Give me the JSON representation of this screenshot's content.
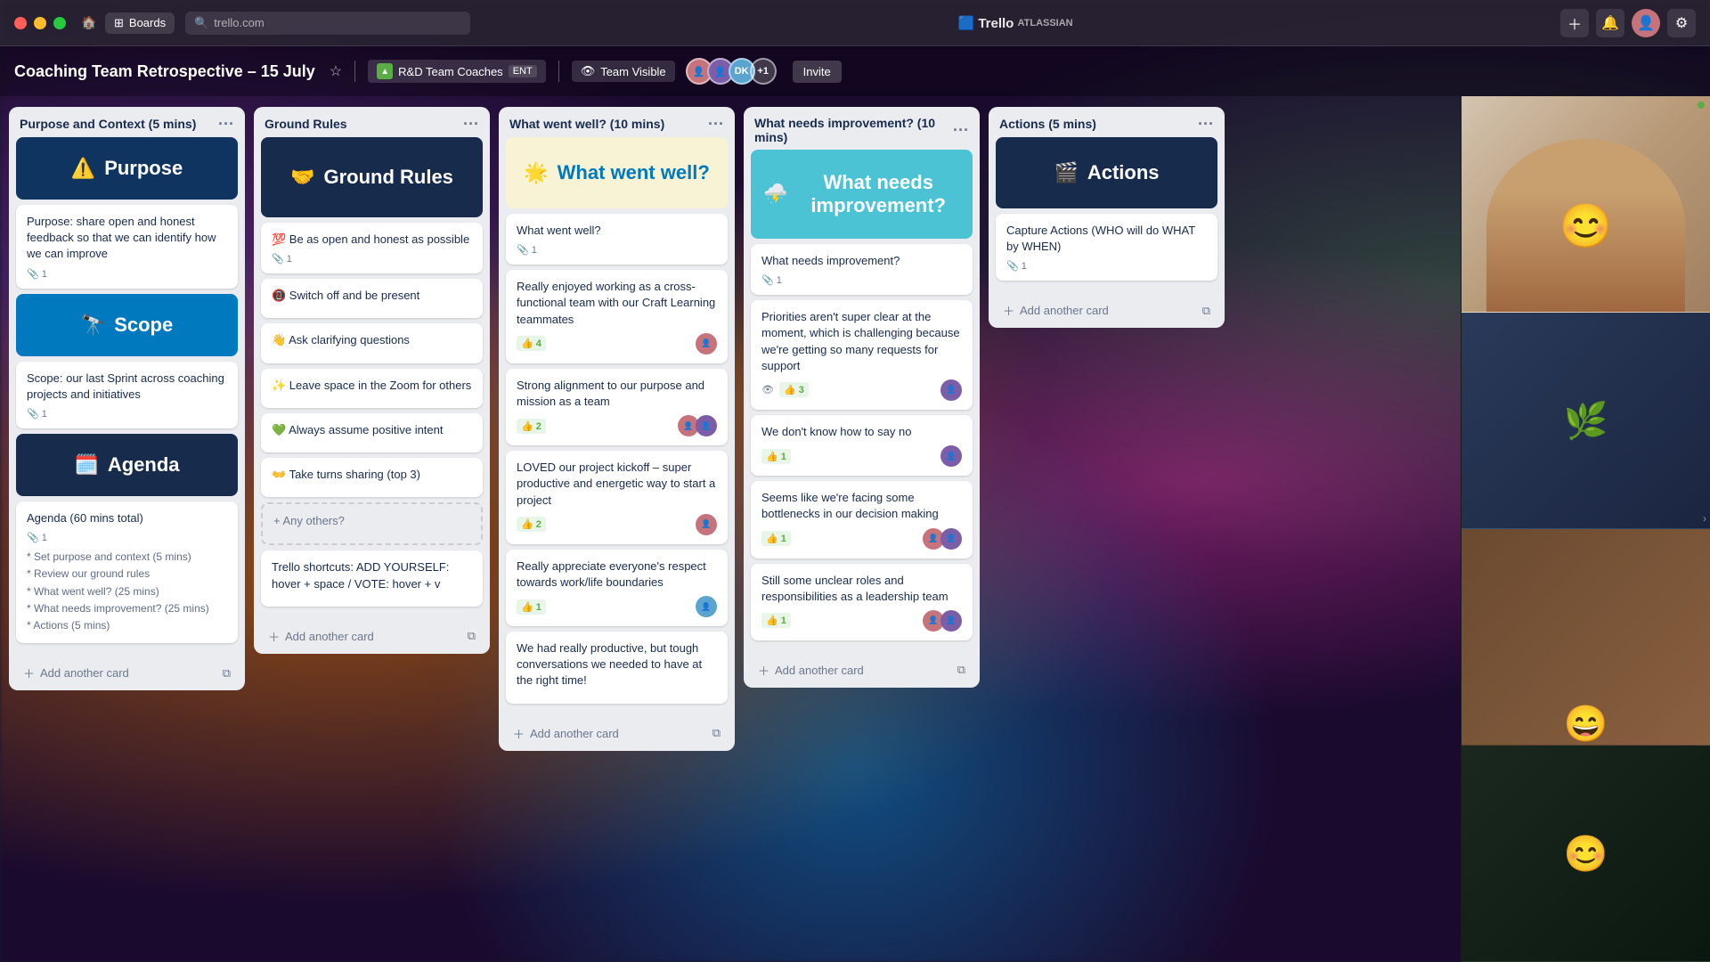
{
  "window": {
    "title": "Trello - Coaching Team Retrospective – 15 July",
    "boards_label": "Boards",
    "address_bar": "trello.com"
  },
  "trello": {
    "logo": "🟦 Trello",
    "logo_sub": "ATLASSIAN"
  },
  "header": {
    "board_title": "Coaching Team Retrospective – 15 July",
    "workspace": "R&D Team Coaches",
    "workspace_tag": "ENT",
    "visibility": "Team Visible",
    "invite_label": "Invite",
    "members": [
      "DK",
      "+1"
    ]
  },
  "columns": [
    {
      "id": "purpose",
      "title": "Purpose and Context (5 mins)",
      "cards": [
        {
          "type": "banner",
          "emoji": "⚠️",
          "text": "Purpose",
          "color": "blue"
        },
        {
          "type": "normal",
          "text": "Purpose: share open and honest feedback so that we can identify how we can improve",
          "attachments": 1
        },
        {
          "type": "banner",
          "emoji": "🔭",
          "text": "Scope",
          "color": "mid-blue"
        },
        {
          "type": "normal",
          "text": "Scope: our last Sprint across coaching projects and initiatives",
          "attachments": 1
        },
        {
          "type": "banner",
          "emoji": "🗓️",
          "text": "Agenda",
          "color": "dark"
        },
        {
          "type": "normal",
          "text": "Agenda (60 mins total)",
          "attachments": 1,
          "extra_lines": [
            "* Set purpose and context (5 mins)",
            "* Review our ground rules",
            "* What went well? (25 mins)",
            "* What needs improvement? (25 mins)",
            "* Actions (5 mins)"
          ]
        }
      ],
      "add_card": "Add another card"
    },
    {
      "id": "ground-rules",
      "title": "Ground Rules",
      "cards": [
        {
          "type": "banner",
          "emoji": "🤝",
          "text": "Ground Rules",
          "color": "dark"
        },
        {
          "type": "rule",
          "emoji": "💯",
          "text": "Be as open and honest as possible",
          "attachments": 1
        },
        {
          "type": "rule",
          "emoji": "📵",
          "text": "Switch off and be present"
        },
        {
          "type": "rule",
          "emoji": "👋",
          "text": "Ask clarifying questions"
        },
        {
          "type": "rule",
          "emoji": "✨",
          "text": "Leave space in the Zoom for others"
        },
        {
          "type": "rule",
          "emoji": "💚",
          "text": "Always assume positive intent"
        },
        {
          "type": "rule",
          "emoji": "👐",
          "text": "Take turns sharing (top 3)"
        },
        {
          "type": "any-others",
          "text": "+ Any others?"
        },
        {
          "type": "normal",
          "text": "Trello shortcuts: ADD YOURSELF: hover + space / VOTE: hover + v"
        }
      ],
      "add_card": "Add another card"
    },
    {
      "id": "went-well",
      "title": "What went well? (10 mins)",
      "cards": [
        {
          "type": "banner",
          "emoji": "🌟",
          "text": "What went well?",
          "color": "yellow"
        },
        {
          "type": "normal",
          "text": "What went well?",
          "attachments": 1
        },
        {
          "type": "normal",
          "text": "Really enjoyed working as a cross-functional team with our Craft Learning teammates",
          "votes": 4,
          "avatars": [
            "ca1"
          ]
        },
        {
          "type": "normal",
          "text": "Strong alignment to our purpose and mission as a team",
          "votes": 2,
          "avatars": [
            "ca1",
            "ca2"
          ]
        },
        {
          "type": "normal",
          "text": "LOVED our project kickoff – super productive and energetic way to start a project",
          "votes": 2,
          "avatars": [
            "ca1"
          ]
        },
        {
          "type": "normal",
          "text": "Really appreciate everyone's respect towards work/life boundaries",
          "votes": 1,
          "avatars": [
            "ca3"
          ]
        },
        {
          "type": "normal",
          "text": "We had really productive, but tough conversations we needed to have at the right time!"
        }
      ],
      "add_card": "Add another card"
    },
    {
      "id": "needs-improvement",
      "title": "What needs improvement? (10 mins)",
      "cards": [
        {
          "type": "banner",
          "emoji": "⛈️",
          "text": "What needs improvement?",
          "color": "teal"
        },
        {
          "type": "normal",
          "text": "What needs improvement?",
          "attachments": 1
        },
        {
          "type": "normal",
          "text": "Priorities aren't super clear at the moment, which is challenging because we're getting so many requests for support",
          "eye": true,
          "votes": 3,
          "avatars": [
            "ca2"
          ]
        },
        {
          "type": "normal",
          "text": "We don't know how to say no",
          "votes": 1,
          "avatars": [
            "ca2"
          ]
        },
        {
          "type": "normal",
          "text": "Seems like we're facing some bottlenecks in our decision making",
          "votes": 1,
          "avatars": [
            "ca1",
            "ca2"
          ]
        },
        {
          "type": "normal",
          "text": "Still some unclear roles and responsibilities as a leadership team",
          "votes": 1,
          "avatars": [
            "ca1",
            "ca2"
          ]
        }
      ],
      "add_card": "Add another card"
    },
    {
      "id": "actions",
      "title": "Actions (5 mins)",
      "cards": [
        {
          "type": "banner",
          "emoji": "🎬",
          "text": "Actions",
          "color": "dark"
        },
        {
          "type": "normal",
          "text": "Capture Actions (WHO will do WHAT by WHEN)",
          "attachments": 1
        }
      ],
      "add_card": "Add another card"
    }
  ],
  "video_panel": {
    "tiles": [
      {
        "bg": "warm",
        "emoji": "😊"
      },
      {
        "bg": "blue-dark",
        "emoji": "🌿"
      },
      {
        "bg": "brown",
        "emoji": "😄"
      },
      {
        "bg": "dark-green",
        "emoji": "😊"
      }
    ]
  }
}
